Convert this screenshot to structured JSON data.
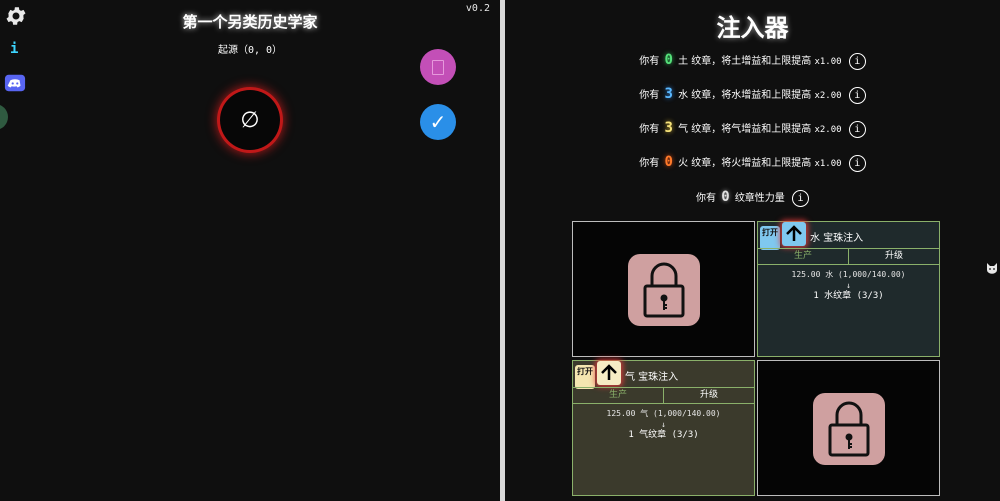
{
  "left": {
    "title": "第一个另类历史学家",
    "version": "v0.2",
    "origin": "起源（0, 0）",
    "info_label": "i",
    "empty_symbol": "∅",
    "confirm_symbol": "✓"
  },
  "right": {
    "title": "注入器",
    "rows": [
      {
        "pre": "你有",
        "count": "0",
        "elem": "土",
        "post": "纹章，将土增益和上限提高",
        "mult": "x1.00",
        "color": "#55e07a"
      },
      {
        "pre": "你有",
        "count": "3",
        "elem": "水",
        "post": "纹章，将水增益和上限提高",
        "mult": "x2.00",
        "color": "#5ab8ff"
      },
      {
        "pre": "你有",
        "count": "3",
        "elem": "气",
        "post": "纹章，将气增益和上限提高",
        "mult": "x2.00",
        "color": "#f5e27a"
      },
      {
        "pre": "你有",
        "count": "0",
        "elem": "火",
        "post": "纹章，将火增益和上限提高",
        "mult": "x1.00",
        "color": "#ff7a2a"
      }
    ],
    "power": {
      "pre": "你有",
      "count": "0",
      "post": "纹章性力量"
    },
    "info_symbol": "i",
    "infusers": [
      {
        "open_label": "打开",
        "name": "水 宝珠注入",
        "tab_produce": "生产",
        "tab_upgrade": "升级",
        "line1": "125.00 水 (1,000/140.00)",
        "arrow": "↓",
        "line2": "1 水纹章 (3/3)"
      },
      {
        "open_label": "打开",
        "name": "气 宝珠注入",
        "tab_produce": "生产",
        "tab_upgrade": "升级",
        "line1": "125.00 气 (1,000/140.00)",
        "arrow": "↓",
        "line2": "1 气纹章 (3/3)"
      }
    ]
  }
}
